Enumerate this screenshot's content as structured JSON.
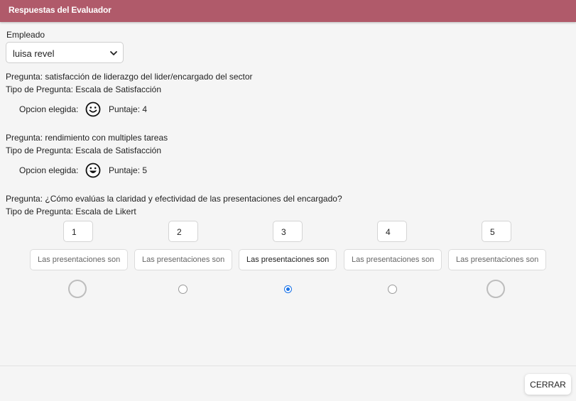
{
  "header": {
    "title": "Respuestas del Evaluador"
  },
  "employee": {
    "label": "Empleado",
    "selected": "luisa revel"
  },
  "questions": [
    {
      "question": "Pregunta: satisfacción de liderazgo del lider/encargado del sector",
      "type": "Tipo de Pregunta: Escala de Satisfacción",
      "chosen_label": "Opcion elegida:",
      "face_icon": "smile-face-icon",
      "score": "Puntaje: 4"
    },
    {
      "question": "Pregunta: rendimiento con multiples tareas",
      "type": "Tipo de Pregunta: Escala de Satisfacción",
      "chosen_label": "Opcion elegida:",
      "face_icon": "grin-face-icon",
      "score": "Puntaje: 5"
    },
    {
      "question": "Pregunta: ¿Cómo evalúas la claridad y efectividad de las presentaciones del encargado?",
      "type": "Tipo de Pregunta: Escala de Likert",
      "options": [
        {
          "number": "1",
          "text": "Las presentaciones son",
          "selected": false
        },
        {
          "number": "2",
          "text": "Las presentaciones son",
          "selected": false
        },
        {
          "number": "3",
          "text": "Las presentaciones son",
          "selected": true
        },
        {
          "number": "4",
          "text": "Las presentaciones son",
          "selected": false
        },
        {
          "number": "5",
          "text": "Las presentaciones son",
          "selected": false
        }
      ]
    }
  ],
  "footer": {
    "close_label": "CERRAR"
  }
}
